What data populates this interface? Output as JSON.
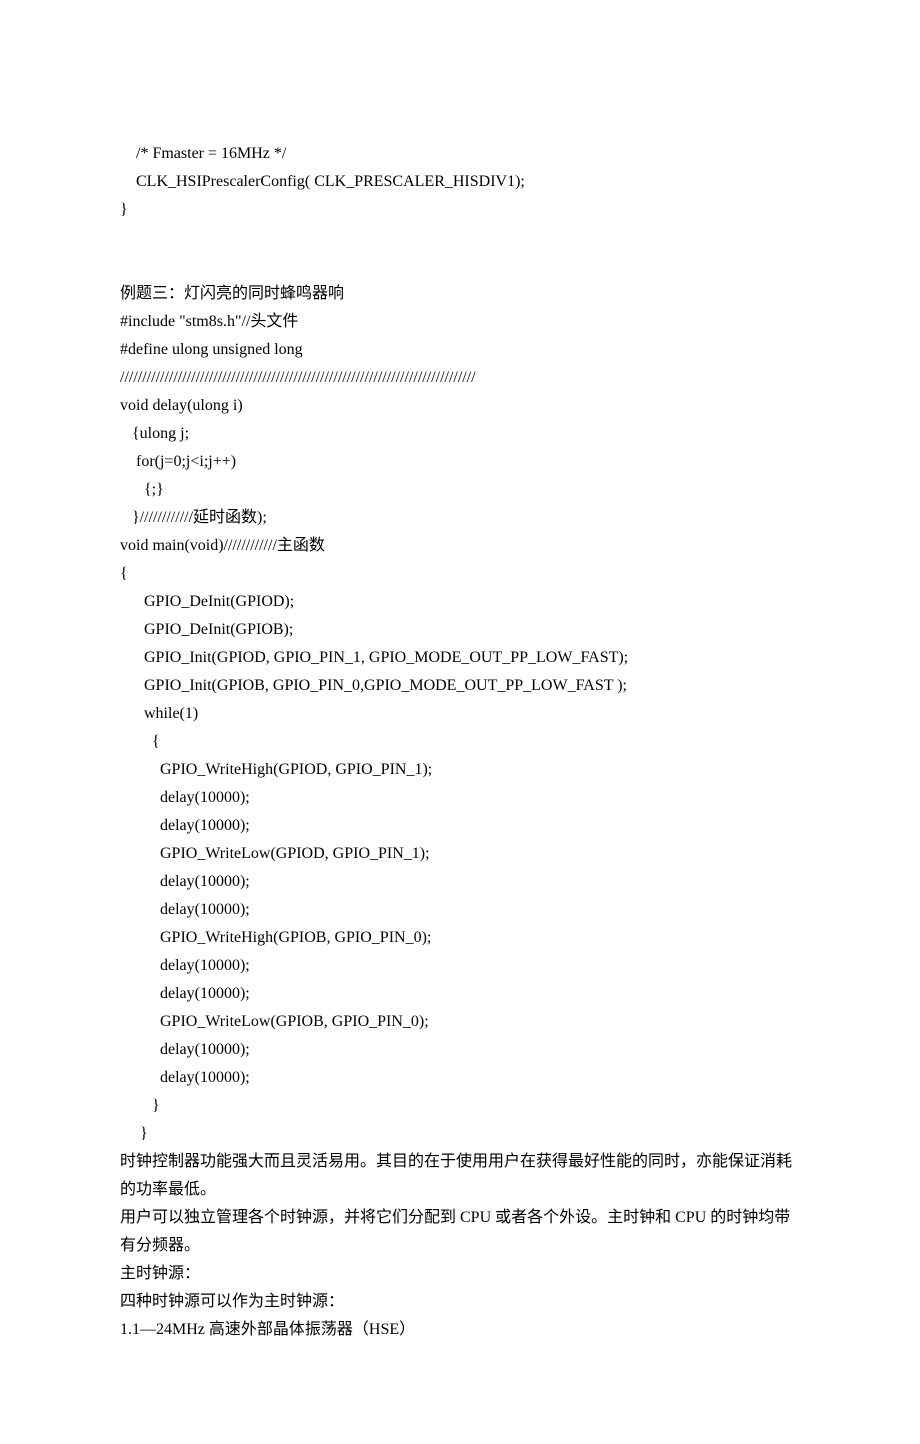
{
  "lines": [
    "    /* Fmaster = 16MHz */",
    "    CLK_HSIPrescalerConfig( CLK_PRESCALER_HISDIV1);",
    "}",
    "",
    "",
    "例题三：灯闪亮的同时蜂鸣器响",
    "#include \"stm8s.h\"//头文件",
    "#define ulong unsigned long",
    "////////////////////////////////////////////////////////////////////////////////",
    "void delay(ulong i)",
    "   {ulong j;",
    "    for(j=0;j<i;j++)",
    "      {;}",
    "   }////////////延时函数);",
    "void main(void)////////////主函数",
    "{",
    "      GPIO_DeInit(GPIOD);",
    "      GPIO_DeInit(GPIOB);",
    "      GPIO_Init(GPIOD, GPIO_PIN_1, GPIO_MODE_OUT_PP_LOW_FAST);",
    "      GPIO_Init(GPIOB, GPIO_PIN_0,GPIO_MODE_OUT_PP_LOW_FAST );",
    "      while(1)",
    "        {",
    "          GPIO_WriteHigh(GPIOD, GPIO_PIN_1);",
    "          delay(10000);",
    "          delay(10000);",
    "          GPIO_WriteLow(GPIOD, GPIO_PIN_1);",
    "          delay(10000);",
    "          delay(10000);",
    "          GPIO_WriteHigh(GPIOB, GPIO_PIN_0);",
    "          delay(10000);",
    "          delay(10000);",
    "          GPIO_WriteLow(GPIOB, GPIO_PIN_0);",
    "          delay(10000);",
    "          delay(10000);",
    "        }",
    "     }",
    "时钟控制器功能强大而且灵活易用。其目的在于使用用户在获得最好性能的同时，亦能保证消耗的功率最低。",
    "用户可以独立管理各个时钟源，并将它们分配到 CPU 或者各个外设。主时钟和 CPU 的时钟均带有分频器。",
    "主时钟源：",
    "四种时钟源可以作为主时钟源：",
    "1.1—24MHz 高速外部晶体振荡器（HSE）"
  ]
}
